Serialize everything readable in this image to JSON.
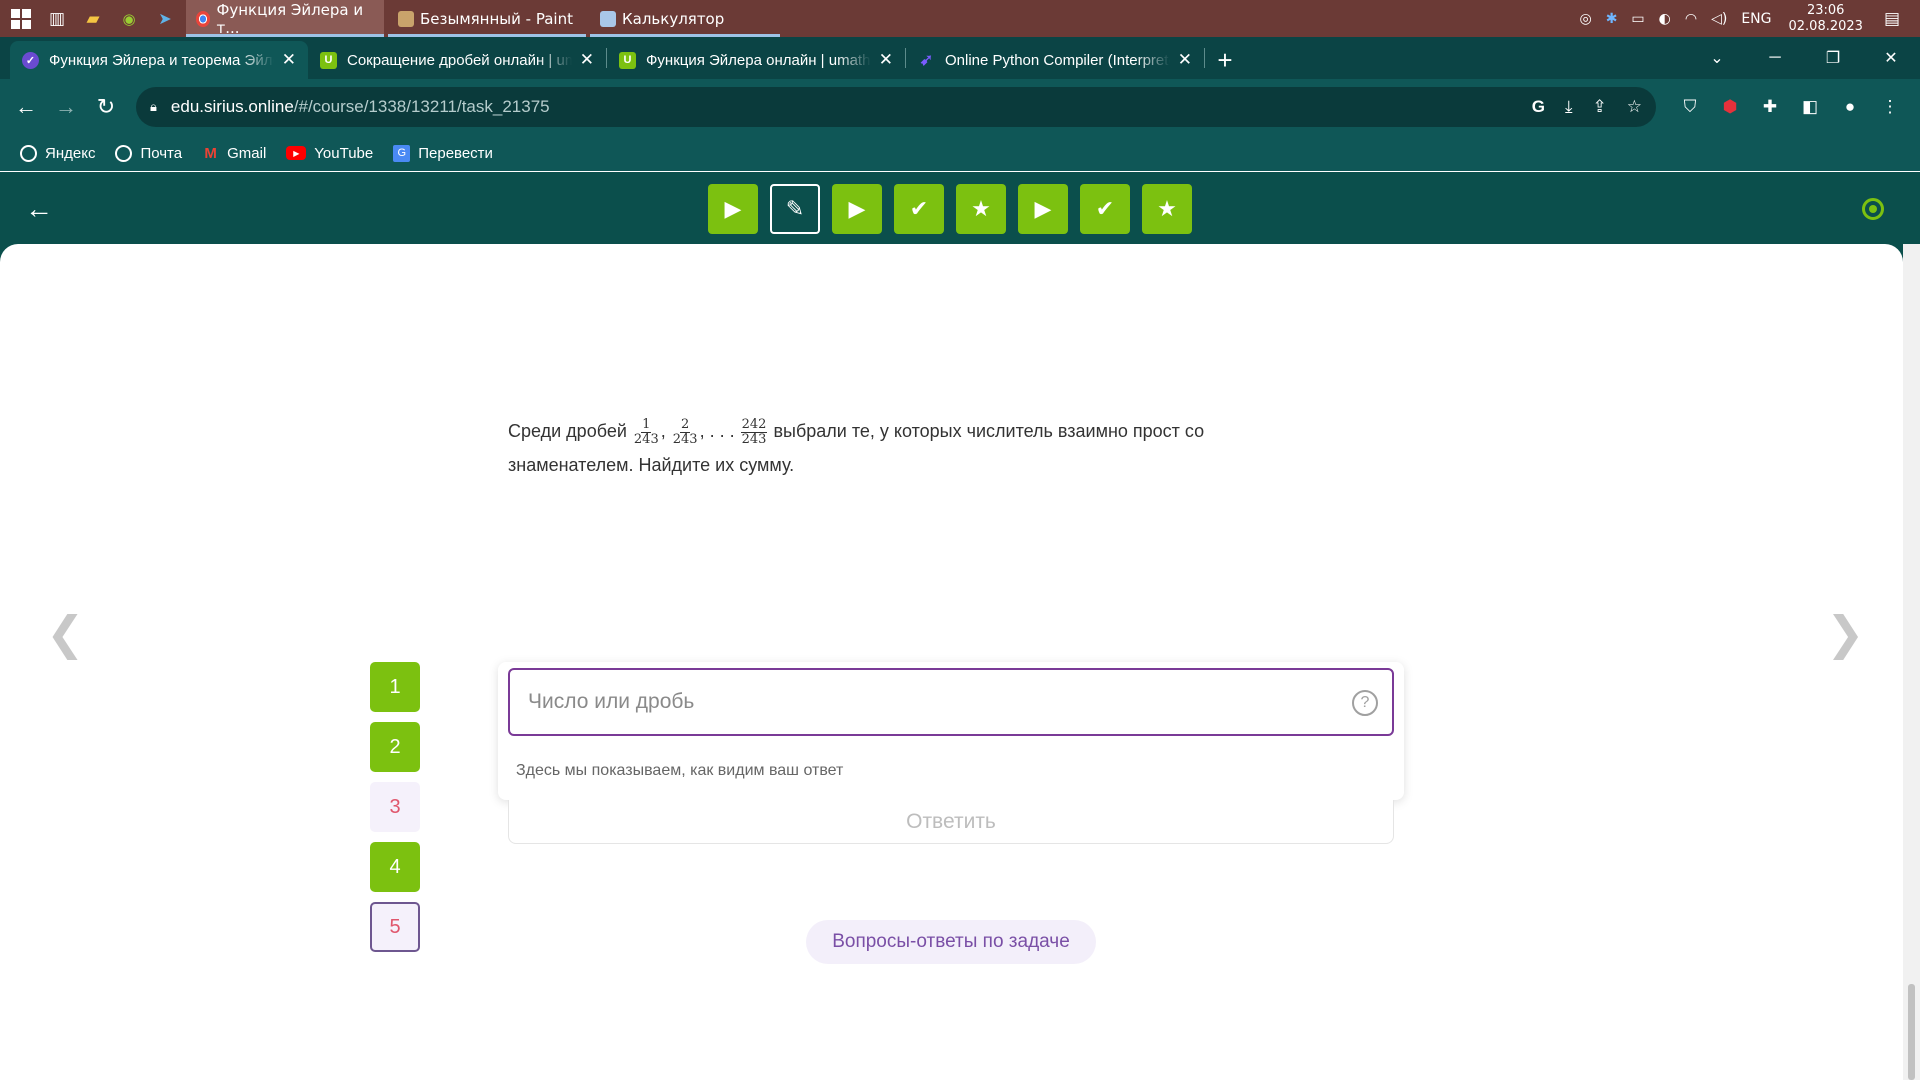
{
  "taskbar": {
    "apps": [
      {
        "label": "Функция Эйлера и т...",
        "active": true
      },
      {
        "label": "Безымянный - Paint",
        "active": false
      },
      {
        "label": "Калькулятор",
        "active": false
      }
    ],
    "lang": "ENG",
    "time": "23:06",
    "date": "02.08.2023"
  },
  "browser": {
    "tabs": [
      {
        "title": "Функция Эйлера и теорема Эйлера",
        "favicon": "sirius"
      },
      {
        "title": "Сокращение дробей онлайн | umath",
        "favicon": "U"
      },
      {
        "title": "Функция Эйлера онлайн | umath",
        "favicon": "U"
      },
      {
        "title": "Online Python Compiler (Interpreter)",
        "favicon": "python"
      }
    ],
    "url_host": "edu.sirius.online",
    "url_path": "/#/course/1338/13211/task_21375",
    "bookmarks": [
      "Яндекс",
      "Почта",
      "Gmail",
      "YouTube",
      "Перевести"
    ]
  },
  "header": {
    "progress": [
      {
        "state": "video",
        "icon": "play-icon"
      },
      {
        "state": "current",
        "icon": "pencil-icon"
      },
      {
        "state": "video",
        "icon": "play-icon"
      },
      {
        "state": "solved",
        "icon": "check-icon"
      },
      {
        "state": "star",
        "icon": "star-icon"
      },
      {
        "state": "video",
        "icon": "play-icon"
      },
      {
        "state": "solved",
        "icon": "check-icon"
      },
      {
        "state": "star",
        "icon": "star-icon"
      }
    ]
  },
  "task": {
    "text_before": "Среди дробей",
    "fractions": [
      {
        "num": "1",
        "den": "243"
      },
      {
        "num": "2",
        "den": "243"
      },
      {
        "num": "242",
        "den": "243"
      }
    ],
    "text_after": "выбрали те, у которых числитель взаимно прост со знаменателем. Найдите их сумму."
  },
  "questions": [
    {
      "label": "1",
      "state": "done"
    },
    {
      "label": "2",
      "state": "done"
    },
    {
      "label": "3",
      "state": "pending"
    },
    {
      "label": "4",
      "state": "done"
    },
    {
      "label": "5",
      "state": "selected"
    }
  ],
  "answer": {
    "placeholder": "Число или дробь",
    "value": "",
    "preview_note": "Здесь мы показываем, как видим ваш ответ",
    "submit_label": "Ответить"
  },
  "qa_label": "Вопросы-ответы по задаче",
  "colors": {
    "accent_green": "#7cc110",
    "header_teal": "#0b4f4c",
    "input_border": "#7a3a97"
  }
}
